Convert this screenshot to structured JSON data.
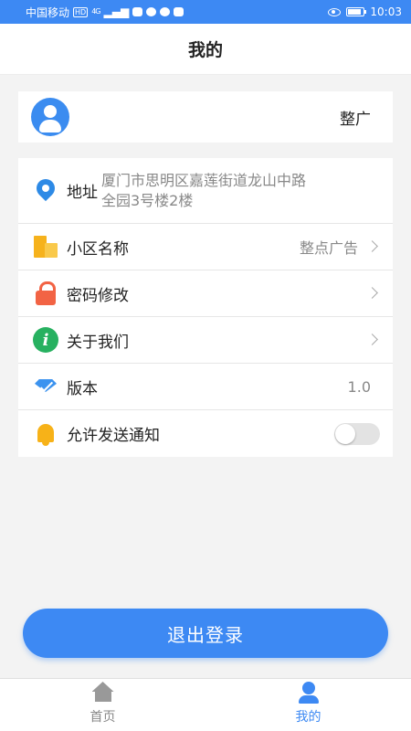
{
  "status_bar": {
    "carrier": "中国移动",
    "hd_badge": "HD",
    "network": "4G",
    "time": "10:03",
    "battery_level": 0.85
  },
  "header": {
    "title": "我的"
  },
  "profile": {
    "name": "整广"
  },
  "settings": {
    "address": {
      "label": "地址",
      "value_line1": "厦门市思明区嘉莲街道龙山中路",
      "value_line2": "全园3号楼2楼"
    },
    "community": {
      "label": "小区名称",
      "value": "整点广告"
    },
    "password": {
      "label": "密码修改"
    },
    "about": {
      "label": "关于我们",
      "icon_glyph": "i"
    },
    "version": {
      "label": "版本",
      "value": "1.0"
    },
    "notify": {
      "label": "允许发送通知",
      "enabled": false
    }
  },
  "logout_label": "退出登录",
  "tabbar": {
    "home_label": "首页",
    "mine_label": "我的",
    "active": "mine"
  },
  "colors": {
    "accent": "#3d89f3",
    "background": "#f3f3f3"
  },
  "icons": [
    "location-pin-icon",
    "building-icon",
    "lock-icon",
    "info-icon",
    "diamond-icon",
    "bell-icon",
    "home-icon",
    "user-icon"
  ]
}
